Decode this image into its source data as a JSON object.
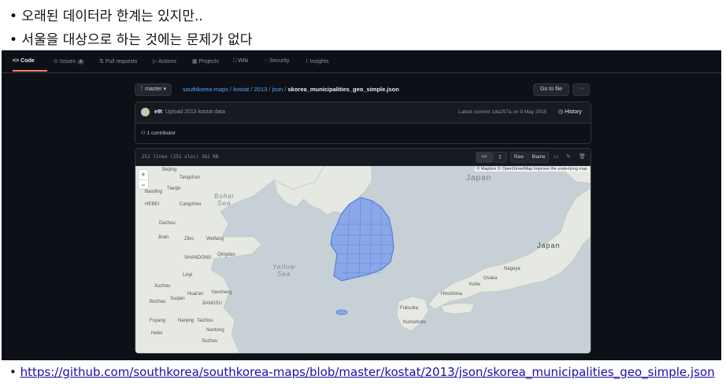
{
  "slide": {
    "bullet1": "• 오래된 데이터라 한계는 있지만..",
    "bullet2": "• 서울을 대상으로 하는 것에는 문제가 없다",
    "footer_bullet": "• ",
    "footer_link": "https://github.com/southkorea/southkorea-maps/blob/master/kostat/2013/json/skorea_municipalities_geo_simple.json"
  },
  "github": {
    "tabs": [
      {
        "icon": "code-icon",
        "label": "Code"
      },
      {
        "icon": "issues-icon",
        "label": "Issues",
        "badge": "6"
      },
      {
        "icon": "pull-request-icon",
        "label": "Pull requests"
      },
      {
        "icon": "play-icon",
        "label": "Actions"
      },
      {
        "icon": "table-icon",
        "label": "Projects"
      },
      {
        "icon": "book-icon",
        "label": "Wiki"
      },
      {
        "icon": "shield-icon",
        "label": "Security"
      },
      {
        "icon": "graph-icon",
        "label": "Insights"
      }
    ],
    "branch": "master",
    "breadcrumbs": [
      "southkorea-maps",
      "kostat",
      "2013",
      "json"
    ],
    "file_name": "skorea_municipalities_geo_simple.json",
    "goto_file": "Go to file",
    "more": "···",
    "commit": {
      "user": "e9t",
      "message": "Upload 2013 kostat data",
      "latest": "Latest commit 1da257a on 9 May 2015",
      "history": "History"
    },
    "contributors": "1 contributor",
    "file_info": "251 lines (251 sloc)   362 KB",
    "toolbar": {
      "raw": "Raw",
      "blame": "Blame"
    },
    "map": {
      "attribution": "© Mapbox © OpenStreetMap Improve the underlying map",
      "zoom_in": "+",
      "zoom_out": "−",
      "seas": {
        "bohai": "Bohai\nSea",
        "yellow": "Yellow\nSea",
        "japan": "Japan"
      },
      "labels": {
        "beijing": "Beijing",
        "tianjin": "Tianjin",
        "baoding": "Baoding",
        "hebei": "HEBEI",
        "tangshan": "Tangshan",
        "cangzhou": "Cangzhou",
        "dezhou": "Dezhou",
        "jinan": "Jinan",
        "weifang": "Weifang",
        "zibo": "Zibo",
        "qingdao": "Qingdao",
        "shandong": "SHANDONG",
        "linyi": "Linyi",
        "xuzhou": "Xuzhou",
        "suqian": "Suqian",
        "jiangsu": "JIANGSU",
        "huaian": "Huai'an",
        "yancheng": "Yancheng",
        "bozhou": "Bozhou",
        "fuyang": "Fuyang",
        "nanjing": "Nanjing",
        "taizhou": "Taizhou",
        "nantong": "Nantong",
        "suzhou": "Suzhou",
        "hefei": "Hefei",
        "japan": "Japan",
        "nagoya": "Nagoya",
        "osaka": "Osaka",
        "kobe": "Kobe",
        "hiroshima": "Hiroshima",
        "fukuoka": "Fukuoka",
        "kumamoto": "Kumamoto"
      }
    }
  }
}
